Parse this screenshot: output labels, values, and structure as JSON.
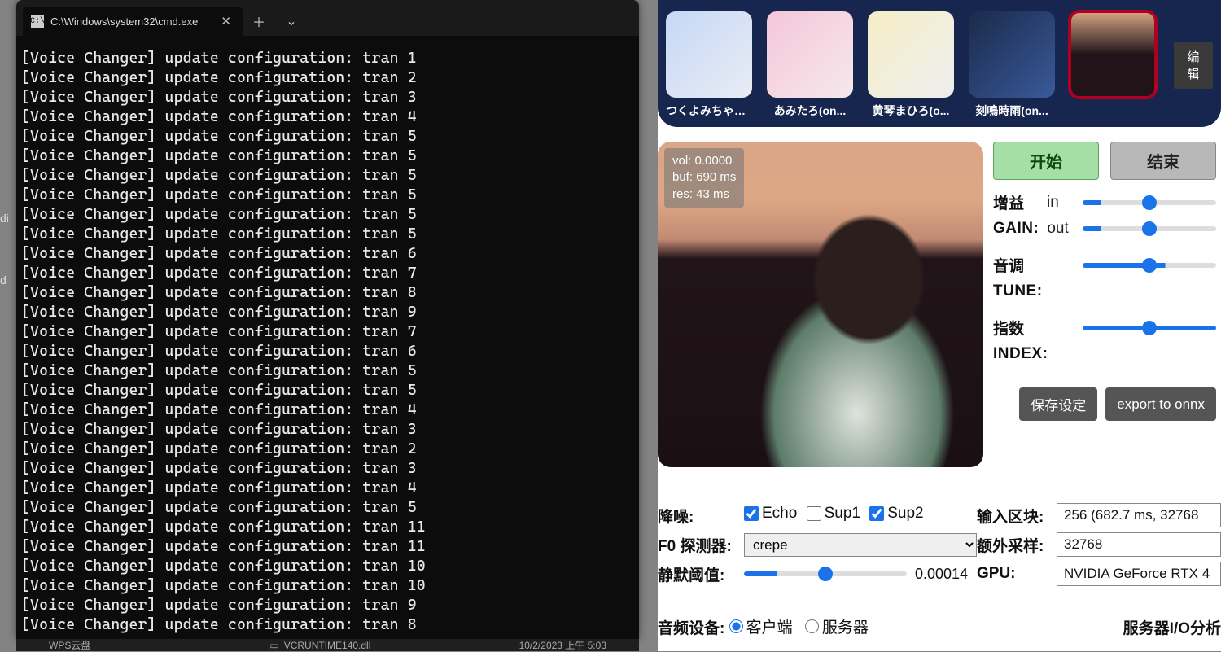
{
  "terminal": {
    "tab_title": "C:\\Windows\\system32\\cmd.exe",
    "lines": [
      "[Voice Changer] update configuration: tran 1",
      "[Voice Changer] update configuration: tran 2",
      "[Voice Changer] update configuration: tran 3",
      "[Voice Changer] update configuration: tran 4",
      "[Voice Changer] update configuration: tran 5",
      "[Voice Changer] update configuration: tran 5",
      "[Voice Changer] update configuration: tran 5",
      "[Voice Changer] update configuration: tran 5",
      "[Voice Changer] update configuration: tran 5",
      "[Voice Changer] update configuration: tran 5",
      "[Voice Changer] update configuration: tran 6",
      "[Voice Changer] update configuration: tran 7",
      "[Voice Changer] update configuration: tran 8",
      "[Voice Changer] update configuration: tran 9",
      "[Voice Changer] update configuration: tran 7",
      "[Voice Changer] update configuration: tran 6",
      "[Voice Changer] update configuration: tran 5",
      "[Voice Changer] update configuration: tran 5",
      "[Voice Changer] update configuration: tran 4",
      "[Voice Changer] update configuration: tran 3",
      "[Voice Changer] update configuration: tran 2",
      "[Voice Changer] update configuration: tran 3",
      "[Voice Changer] update configuration: tran 4",
      "[Voice Changer] update configuration: tran 5",
      "[Voice Changer] update configuration: tran 11",
      "[Voice Changer] update configuration: tran 11",
      "[Voice Changer] update configuration: tran 10",
      "[Voice Changer] update configuration: tran 10",
      "[Voice Changer] update configuration: tran 9",
      "[Voice Changer] update configuration: tran 8"
    ]
  },
  "left_stubs": {
    "a": "di",
    "b": "d"
  },
  "voices": {
    "items": [
      {
        "label": "つくよみちゃん..."
      },
      {
        "label": "あみたろ(on..."
      },
      {
        "label": "黄琴まひろ(o..."
      },
      {
        "label": "刻鳴時雨(on..."
      },
      {
        "label": ""
      }
    ],
    "edit": "编辑"
  },
  "hud": {
    "vol": "vol: 0.0000",
    "buf": "buf: 690 ms",
    "res": "res: 43 ms"
  },
  "buttons": {
    "start": "开始",
    "end": "结束"
  },
  "sliders": {
    "gain_cn": "增益",
    "gain_en": "GAIN:",
    "in": "in",
    "out": "out",
    "tune_cn": "音调",
    "tune_en": "TUNE:",
    "index_cn": "指数",
    "index_en": "INDEX:"
  },
  "save": {
    "save": "保存设定",
    "export": "export to onnx"
  },
  "params": {
    "denoise": "降噪:",
    "echo": "Echo",
    "sup1": "Sup1",
    "sup2": "Sup2",
    "f0_label": "F0 探测器:",
    "f0_value": "crepe",
    "silence_label": "静默阈值:",
    "silence_value": "0.00014",
    "chunk_label": "输入区块:",
    "chunk_value": "256 (682.7 ms, 32768",
    "extra_label": "额外采样:",
    "extra_value": "32768",
    "gpu_label": "GPU:",
    "gpu_value": "NVIDIA GeForce RTX 4"
  },
  "bottom": {
    "audio_dev": "音频设备:",
    "client": "客户端",
    "server": "服务器",
    "io_head": "服务器I/O分析"
  },
  "taskbar": {
    "wps": "WPS云盘",
    "file": "VCRUNTIME140.dll",
    "time": "10/2/2023  上午 5:03"
  }
}
